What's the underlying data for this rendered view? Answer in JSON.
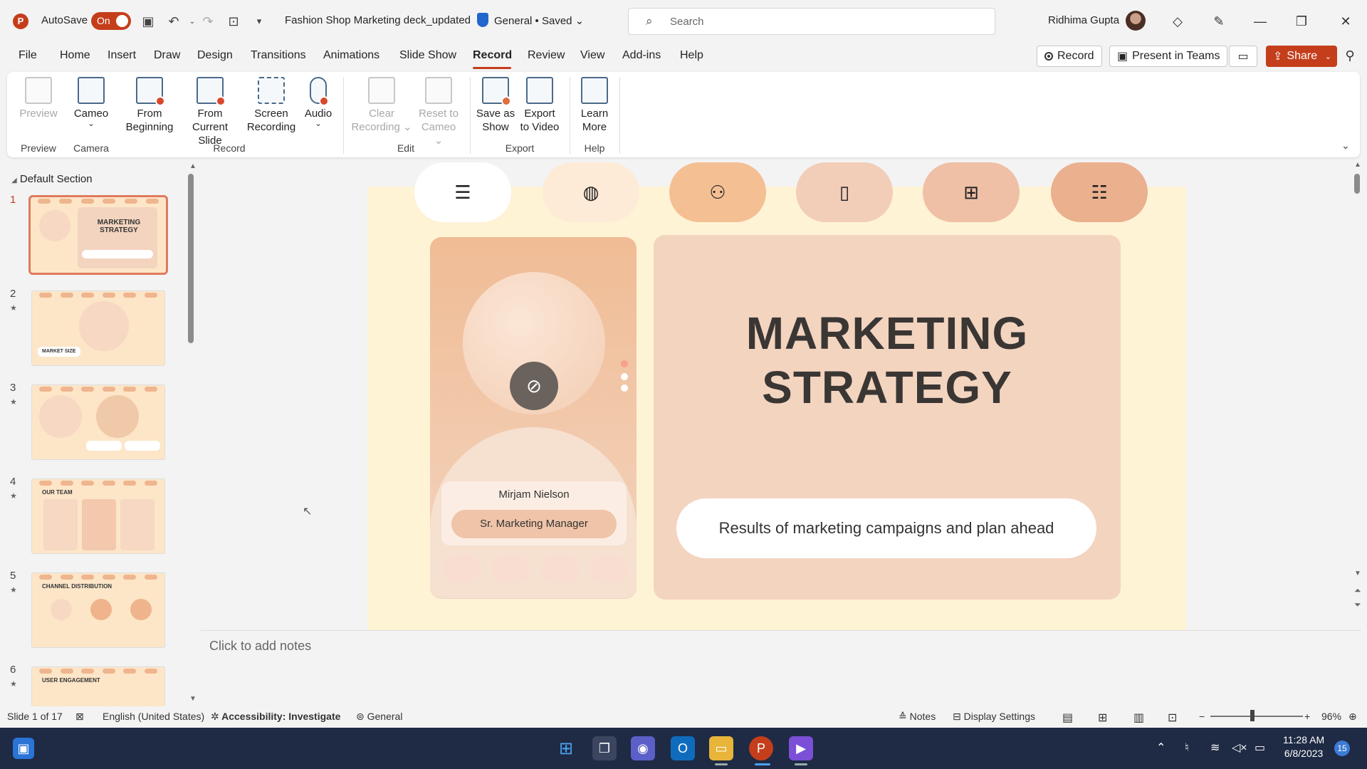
{
  "titlebar": {
    "app_logo": "P",
    "autosave_label": "AutoSave",
    "autosave_state": "On",
    "document_title": "Fashion Shop Marketing deck_updated",
    "sensitivity": "General",
    "save_status": "• Saved",
    "search_placeholder": "Search",
    "user_name": "Ridhima Gupta"
  },
  "menu": {
    "tabs": [
      "File",
      "Home",
      "Insert",
      "Draw",
      "Design",
      "Transitions",
      "Animations",
      "Slide Show",
      "Record",
      "Review",
      "View",
      "Add-ins",
      "Help"
    ],
    "active_tab": "Record",
    "record_button": "Record",
    "present_teams_button": "Present in Teams",
    "share_button": "Share"
  },
  "ribbon": {
    "buttons": {
      "preview": [
        "Preview"
      ],
      "cameo": [
        "Cameo"
      ],
      "from_beginning": [
        "From",
        "Beginning"
      ],
      "from_current": [
        "From",
        "Current Slide"
      ],
      "screen_recording": [
        "Screen",
        "Recording"
      ],
      "audio": [
        "Audio"
      ],
      "clear_recording": [
        "Clear",
        "Recording"
      ],
      "reset_to_cameo": [
        "Reset to",
        "Cameo"
      ],
      "save_as_show": [
        "Save as",
        "Show"
      ],
      "export_to_video": [
        "Export",
        "to Video"
      ],
      "learn_more": [
        "Learn",
        "More"
      ]
    },
    "groups": [
      "Preview",
      "Camera",
      "Record",
      "Edit",
      "Export",
      "Help"
    ]
  },
  "thumbnails": {
    "section_label": "Default Section",
    "slides": [
      {
        "number": "1",
        "title": "MARKETING STRATEGY",
        "selected": true
      },
      {
        "number": "2",
        "title": "MARKET SIZE"
      },
      {
        "number": "3",
        "title": ""
      },
      {
        "number": "4",
        "title": "OUR TEAM"
      },
      {
        "number": "5",
        "title": "CHANNEL DISTRIBUTION"
      },
      {
        "number": "6",
        "title": "USER ENGAGEMENT"
      }
    ]
  },
  "slide": {
    "title_line1": "MARKETING",
    "title_line2": "STRATEGY",
    "person_name": "Mirjam Nielson",
    "person_role": "Sr. Marketing Manager",
    "subtitle": "Results of marketing campaigns and plan ahead",
    "nav_icons": [
      "menu-icon",
      "globe-icon",
      "people-icon",
      "phone-icon",
      "monitor-icon",
      "presentation-icon"
    ]
  },
  "notes_placeholder": "Click to add notes",
  "statusbar": {
    "slide_count": "Slide 1 of 17",
    "language": "English (United States)",
    "accessibility": "Accessibility: Investigate",
    "sensitivity": "General",
    "notes": "Notes",
    "display_settings": "Display Settings",
    "zoom": "96%"
  },
  "taskbar": {
    "time": "11:28 AM",
    "date": "6/8/2023",
    "notification_count": "15"
  },
  "colors": {
    "accent": "#c43e1c",
    "slide_bg": "#fff3d6",
    "card": "#f3d4bf",
    "taskbar": "#1f2a44"
  }
}
